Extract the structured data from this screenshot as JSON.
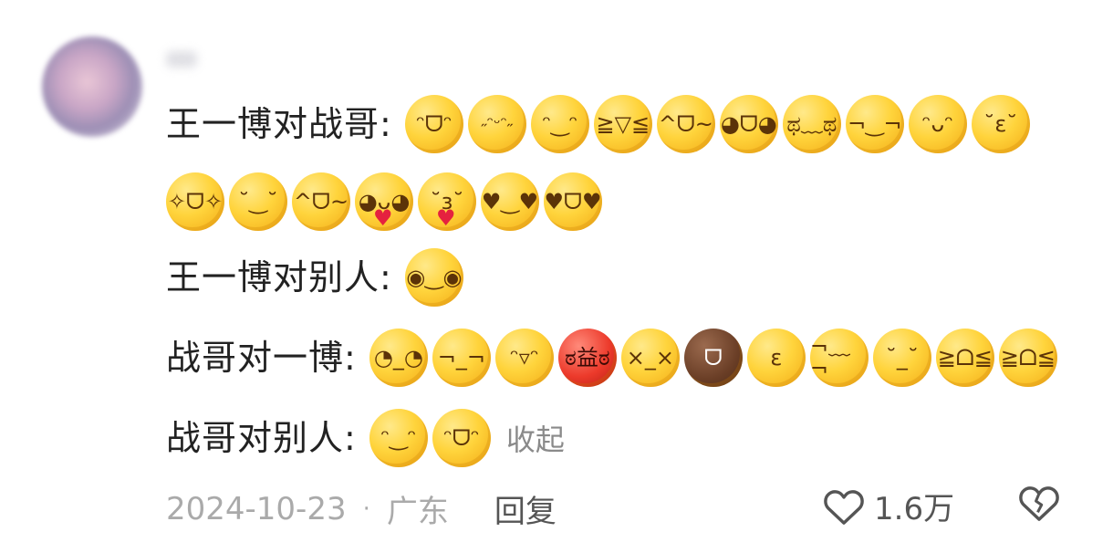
{
  "comment": {
    "lines": [
      {
        "label": "王一博对战哥",
        "colon": ":",
        "emojis": [
          "grin",
          "beam",
          "smile",
          "laugh",
          "wink-peace",
          "silly",
          "anxious",
          "smirk",
          "hug",
          "blush"
        ]
      },
      {
        "label": "",
        "colon": "",
        "emojis": [
          "starstruck",
          "content",
          "wink-peace",
          "heart-hands",
          "kiss",
          "heart-eyes",
          "heart-tongue"
        ]
      },
      {
        "label": "王一博对别人",
        "colon": ":",
        "emojis": [
          "plain-smile"
        ]
      },
      {
        "label": "战哥对一博",
        "colon": ":",
        "emojis": [
          "eye-roll",
          "annoyed",
          "sweat-grin",
          "angry",
          "facepalm",
          "brown-laugh",
          "pout",
          "sideeye-sweat",
          "thinking",
          "scream",
          "scream"
        ]
      },
      {
        "label": "战哥对别人",
        "colon": ":",
        "emojis": [
          "smile",
          "grin"
        ],
        "collapse_label": "收起"
      }
    ]
  },
  "meta": {
    "date": "2024-10-23",
    "separator": "·",
    "location": "广东",
    "reply_label": "回复",
    "like_count": "1.6万"
  },
  "icons": {
    "like": "heart-outline-icon",
    "dislike": "broken-heart-icon"
  }
}
